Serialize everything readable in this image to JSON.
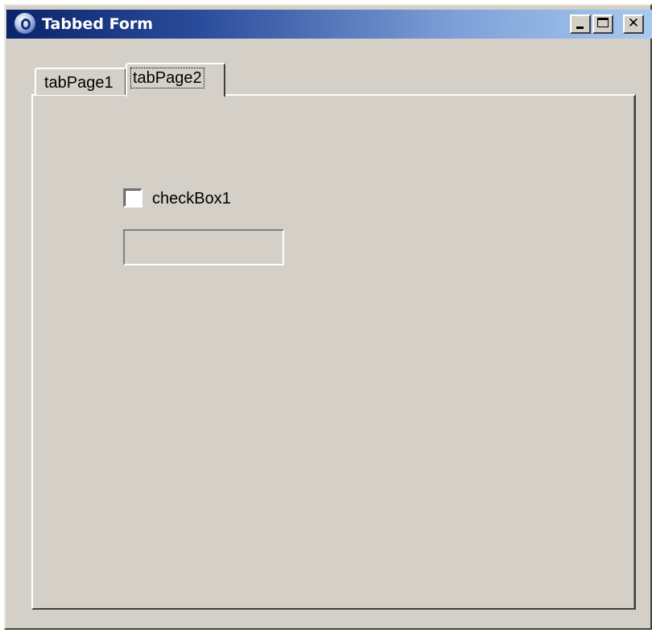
{
  "window": {
    "title": "Tabbed Form",
    "app_icon": "app-icon",
    "controls": {
      "minimize": "minimize-icon",
      "maximize": "maximize-icon",
      "close": "close-icon"
    }
  },
  "tabs": [
    {
      "label": "tabPage1",
      "selected": false
    },
    {
      "label": "tabPage2",
      "selected": true
    }
  ],
  "tab_page": {
    "checkbox": {
      "label": "checkBox1",
      "checked": false
    },
    "textbox": {
      "value": "",
      "disabled": true
    }
  },
  "colors": {
    "face": "#d4d0c8",
    "title_start": "#0a246a",
    "title_end": "#a6caf0"
  }
}
